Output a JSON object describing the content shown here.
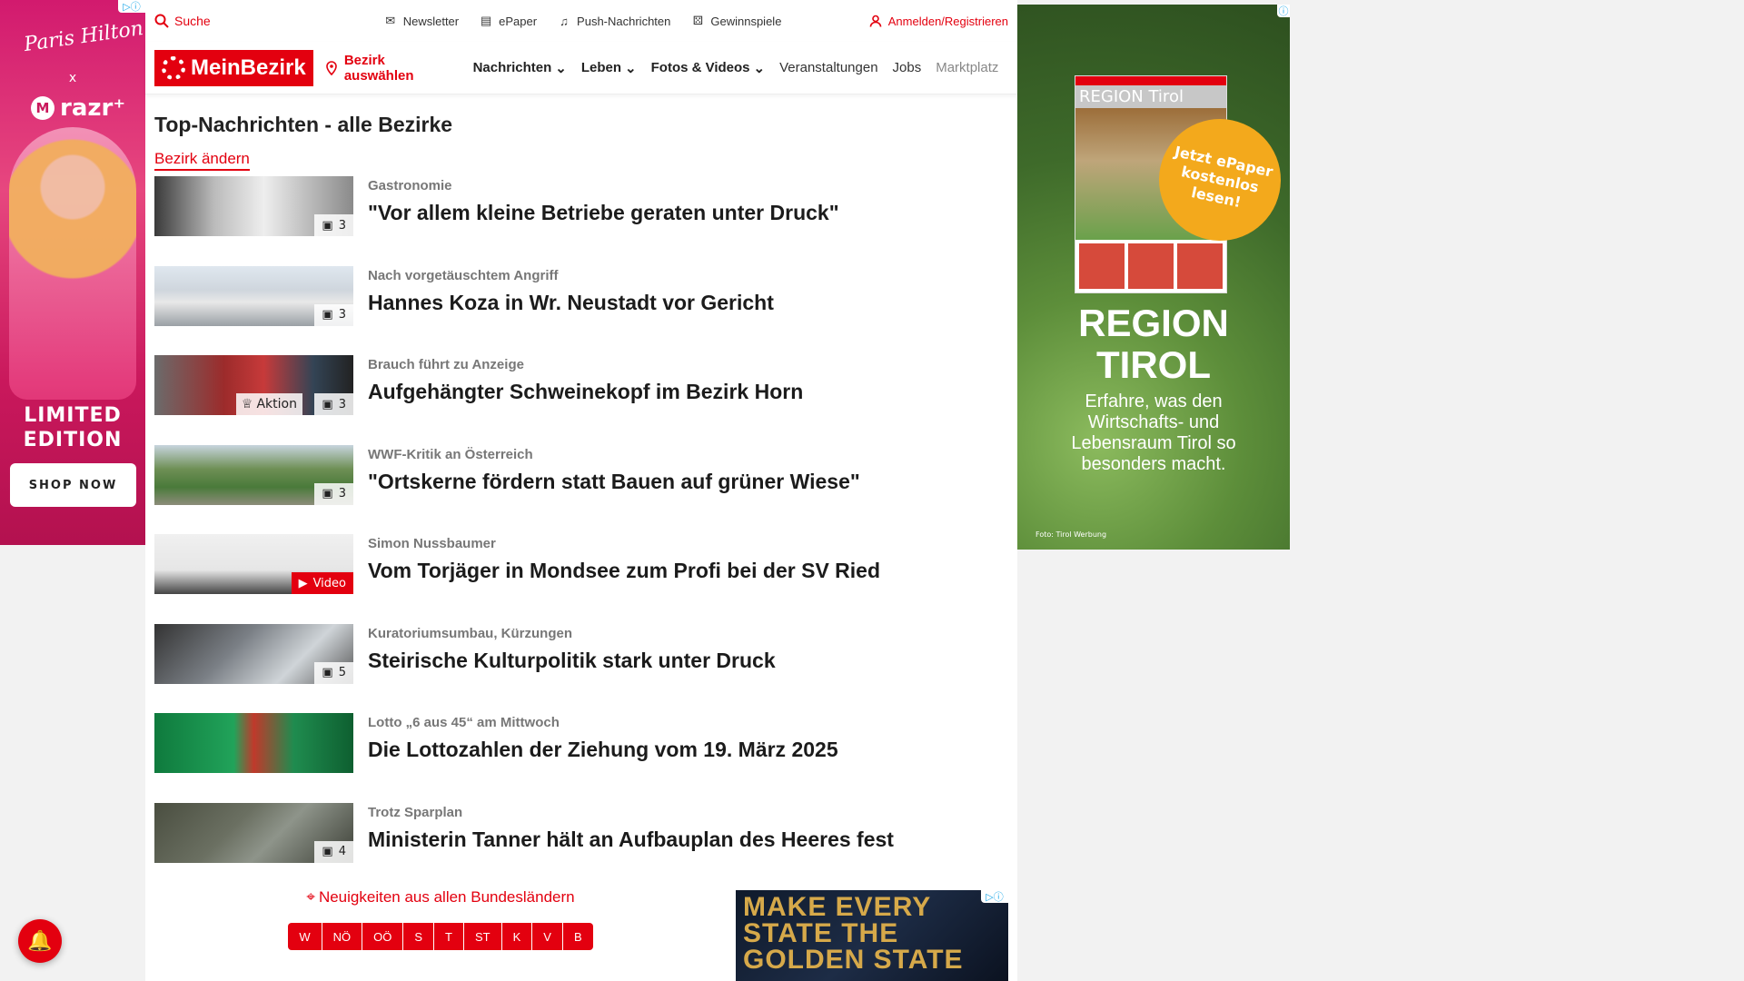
{
  "ad_left": {
    "signature": "Paris Hilton",
    "x": "x",
    "brand": "razr⁺",
    "brand_mark": "M",
    "headline": "LIMITED EDITION",
    "cta": "SHOP NOW"
  },
  "topbar": {
    "search": "Suche",
    "newsletter": "Newsletter",
    "epaper": "ePaper",
    "push": "Push-Nachrichten",
    "gewinnspiele": "Gewinnspiele",
    "login": "Anmelden/Registrieren"
  },
  "nav": {
    "logo": "MeinBezirk",
    "bezirk_select": "Bezirk auswählen",
    "items": [
      "Nachrichten",
      "Leben",
      "Fotos & Videos",
      "Veranstaltungen",
      "Jobs",
      "Marktplatz"
    ]
  },
  "page": {
    "title": "Top-Nachrichten - alle Bezirke",
    "change_bezirk": "Bezirk ändern"
  },
  "articles": [
    {
      "category": "Gastronomie",
      "title": "\"Vor allem kleine Betriebe geraten unter Druck\"",
      "badge": "3"
    },
    {
      "category": "Nach vorgetäuschtem Angriff",
      "title": "Hannes Koza in Wr. Neustadt vor Gericht",
      "badge": "3"
    },
    {
      "category": "Brauch führt zu Anzeige",
      "title": "Aufgehängter Schweinekopf im Bezirk Horn",
      "badge": "3",
      "extra": "Aktion"
    },
    {
      "category": "WWF-Kritik an Österreich",
      "title": "\"Ortskerne fördern statt Bauen auf grüner Wiese\"",
      "badge": "3"
    },
    {
      "category": "Simon Nussbaumer",
      "title": "Vom Torjäger in Mondsee zum Profi bei der SV Ried",
      "badge": "Video"
    },
    {
      "category": "Kuratoriumsumbau, Kürzungen",
      "title": "Steirische Kulturpolitik stark unter Druck",
      "badge": "5"
    },
    {
      "category": "Lotto „6 aus 45“ am Mittwoch",
      "title": "Die Lottozahlen der Ziehung vom 19. März 2025",
      "badge": ""
    },
    {
      "category": "Trotz Sparplan",
      "title": "Ministerin Tanner hält an Aufbauplan des Heeres fest",
      "badge": "4"
    }
  ],
  "bundeslaender": {
    "title": "Neuigkeiten aus allen Bundesländern",
    "buttons": [
      "W",
      "NÖ",
      "OÖ",
      "S",
      "T",
      "ST",
      "K",
      "V",
      "B"
    ]
  },
  "ad_bottom": {
    "text": "MAKE EVERY STATE THE GOLDEN STATE"
  },
  "ad_right": {
    "epaper_title": "REGION Tirol",
    "circle": "Jetzt ePaper kostenlos lesen!",
    "headline": "REGION TIROL",
    "description": "Erfahre, was den Wirtschafts- und Lebensraum Tirol so besonders macht.",
    "credit": "Foto: Tirol Werbung"
  },
  "colors": {
    "brand_red": "#e3000f"
  }
}
